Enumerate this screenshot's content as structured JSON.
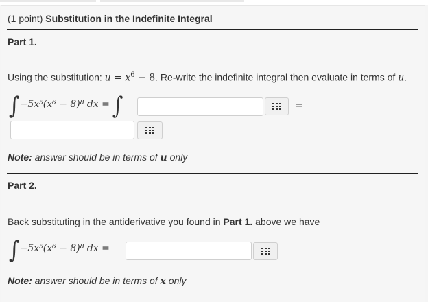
{
  "header": {
    "points": "(1 point)",
    "title": "Substitution in the Indefinite Integral"
  },
  "part1": {
    "label": "Part 1.",
    "instruction_pre": "Using the substitution: ",
    "instruction_post": ". Re-write the indefinite integral then evaluate in terms of ",
    "sub_u": "u",
    "sub_eq": " = ",
    "sub_x": "x",
    "sub_exp": "6",
    "sub_rest": " − 8",
    "var_u": "u",
    "period": ".",
    "integrand": "−5x⁵(x⁶ − 8)⁸ dx =",
    "equals": "=",
    "input1_value": "",
    "input2_value": "",
    "note_label": "Note:",
    "note_text": " answer should be in terms of ",
    "note_var": "u",
    "note_end": " only"
  },
  "part2": {
    "label": "Part 2.",
    "instruction_pre": "Back substituting in the antiderivative you found in ",
    "instruction_bold": "Part 1.",
    "instruction_post": " above we have",
    "integrand": "−5x⁵(x⁶ − 8)⁸ dx =",
    "input_value": "",
    "note_label": "Note:",
    "note_text": " answer should be in terms of ",
    "note_var": "x",
    "note_end": " only"
  },
  "icons": {
    "keyboard": "equation-editor-icon"
  }
}
